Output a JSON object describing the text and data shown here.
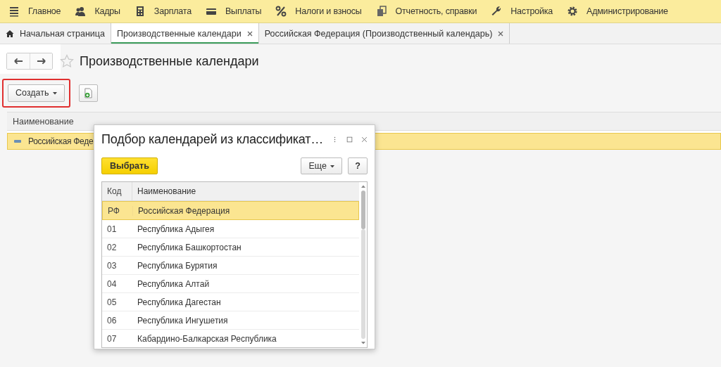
{
  "menu": [
    {
      "label": "Главное"
    },
    {
      "label": "Кадры"
    },
    {
      "label": "Зарплата"
    },
    {
      "label": "Выплаты"
    },
    {
      "label": "Налоги и взносы"
    },
    {
      "label": "Отчетность, справки"
    },
    {
      "label": "Настройка"
    },
    {
      "label": "Администрирование"
    }
  ],
  "tabs": [
    {
      "label": "Начальная страница",
      "selected": false,
      "home": true,
      "closable": false
    },
    {
      "label": "Производственные календари",
      "selected": true,
      "home": false,
      "closable": true
    },
    {
      "label": "Российская Федерация (Производственный календарь)",
      "selected": false,
      "home": false,
      "closable": true
    }
  ],
  "page": {
    "title": "Производственные календари",
    "favorite": false,
    "create_button": "Создать",
    "highlighted": true
  },
  "table": {
    "columns": [
      "Наименование"
    ],
    "rows": [
      {
        "name": "Российская Феде",
        "selected": true
      }
    ]
  },
  "dialog": {
    "title": "Подбор календарей из классификат…",
    "select_button": "Выбрать",
    "more_button": "Еще",
    "help_button": "?",
    "columns": [
      "Код",
      "Наименование"
    ],
    "rows": [
      {
        "code": "РФ",
        "name": "Российская Федерация",
        "selected": true
      },
      {
        "code": "01",
        "name": "Республика Адыгея",
        "selected": false
      },
      {
        "code": "02",
        "name": "Республика Башкортостан",
        "selected": false
      },
      {
        "code": "03",
        "name": "Республика Бурятия",
        "selected": false
      },
      {
        "code": "04",
        "name": "Республика Алтай",
        "selected": false
      },
      {
        "code": "05",
        "name": "Республика Дагестан",
        "selected": false
      },
      {
        "code": "06",
        "name": "Республика Ингушетия",
        "selected": false
      },
      {
        "code": "07",
        "name": "Кабардино-Балкарская Республика",
        "selected": false
      }
    ]
  }
}
